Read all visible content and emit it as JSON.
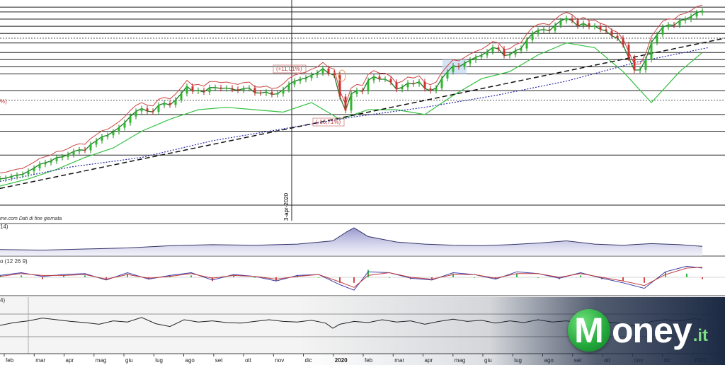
{
  "chart_data": {
    "type": "line",
    "title": "",
    "source_caption": "me.com Dati di fine giornata",
    "crosshair_date_label": "3-apr-2020",
    "x_tick_labels": [
      "feb",
      "mar",
      "apr",
      "mag",
      "giu",
      "lug",
      "ago",
      "set",
      "ott",
      "nov",
      "dic",
      "2020",
      "feb",
      "mar",
      "apr",
      "mag",
      "giu",
      "lug",
      "ago",
      "set",
      "ott",
      "nov",
      "dic",
      "2021"
    ],
    "annotations": [
      "(+11,01%)",
      "(-16,71%)",
      "%)"
    ],
    "panel_labels": {
      "atr": "14)",
      "macd": "o (12 26 9)",
      "rsi": "4)"
    },
    "price_series": {
      "name": "",
      "x_index": [
        0,
        8,
        16,
        24,
        32,
        40,
        48,
        56,
        64,
        72,
        80,
        88,
        96,
        104,
        112,
        120,
        128,
        136,
        144,
        152,
        160,
        168,
        176,
        184,
        192,
        200,
        208,
        216,
        224,
        232,
        240,
        248,
        256,
        264,
        272,
        280,
        288,
        296,
        304,
        312,
        320,
        328,
        336,
        344,
        352,
        360,
        368,
        376,
        384,
        392,
        400,
        408,
        416,
        424,
        432,
        440,
        448,
        456,
        464,
        472,
        480,
        488,
        496,
        504,
        512,
        520,
        528,
        536,
        544,
        552,
        560,
        568,
        576,
        584,
        592,
        600,
        608,
        616,
        624,
        632,
        640,
        648,
        656,
        664,
        672,
        680,
        688,
        696,
        704,
        712,
        720,
        728,
        736,
        744,
        752,
        760,
        768,
        776,
        784,
        792,
        800,
        808,
        816,
        824,
        832,
        840,
        848,
        856,
        864,
        872,
        880,
        888,
        896,
        904,
        912,
        920,
        928,
        936,
        944,
        952,
        960,
        968,
        976,
        984,
        992
      ],
      "values": [
        11,
        11.3,
        12,
        12.6,
        12.9,
        14.2,
        15.5,
        17.1,
        17.8,
        18.5,
        20,
        20.2,
        21.2,
        22.5,
        23.2,
        23,
        25.4,
        27,
        28.7,
        29.3,
        30.8,
        32.5,
        34.5,
        37.2,
        39.3,
        40.5,
        39.4,
        39.1,
        41.9,
        42.7,
        42,
        44.1,
        46.8,
        49.8,
        47.8,
        48.1,
        47.4,
        49.3,
        49.3,
        48.9,
        49.1,
        48.6,
        48.1,
        48.9,
        49.1,
        47.1,
        47,
        47.4,
        46.4,
        46.7,
        48.4,
        50.6,
        52,
        52.7,
        53.3,
        54.5,
        55.4,
        57.3,
        55.3,
        54.5,
        45.5,
        39.7,
        46.6,
        48.1,
        47.7,
        52.3,
        53.9,
        52.8,
        52.8,
        51.5,
        48.6,
        49.4,
        51.2,
        50.8,
        51.7,
        48.9,
        48,
        49.1,
        53.1,
        55.9,
        58.4,
        58,
        59.4,
        60.8,
        62,
        62.8,
        64.3,
        66.1,
        65.5,
        62.7,
        63.1,
        64.8,
        65.7,
        69.2,
        71.9,
        73.3,
        73.6,
        73.1,
        75.4,
        77.3,
        78.3,
        77.4,
        75.1,
        76.2,
        74.9,
        75.1,
        73.7,
        73,
        71,
        70,
        67.2,
        61.8,
        56.6,
        56.7,
        61,
        68.2,
        71.5,
        74.6,
        75.6,
        75.4,
        77.3,
        77.9,
        79.1,
        80.7,
        81.4
      ]
    },
    "volatility_band": {
      "name": "",
      "x_index": [
        0,
        40,
        80,
        120,
        160,
        200,
        240,
        280,
        320,
        360,
        400,
        440,
        480,
        520,
        560,
        600,
        640,
        680,
        720,
        760,
        800,
        840,
        880,
        920,
        960,
        992
      ],
      "values": [
        8,
        11,
        15,
        20,
        24,
        31,
        36,
        40,
        41,
        40,
        39,
        43,
        36,
        40,
        40,
        38,
        46,
        53,
        56,
        63,
        68,
        66,
        56,
        43,
        56,
        64
      ]
    },
    "moving_average_dotted": {
      "name": "",
      "x_index": [
        0,
        100,
        200,
        300,
        400,
        500,
        600,
        700,
        800,
        900,
        1000
      ],
      "values": [
        10,
        16,
        20,
        27,
        32,
        37,
        41,
        46,
        52,
        60,
        66
      ]
    },
    "trendline_dashed": {
      "name": "",
      "x_index": [
        0,
        1024
      ],
      "values": [
        7,
        70
      ]
    },
    "horizontal_levels": [
      83,
      81,
      78,
      75,
      72,
      70,
      68,
      64,
      61,
      58,
      55,
      48,
      44,
      38,
      31,
      21
    ],
    "atr": {
      "name": "",
      "x_index": [
        0,
        60,
        120,
        180,
        240,
        300,
        360,
        420,
        470,
        490,
        500,
        520,
        560,
        600,
        640,
        680,
        720,
        760,
        800,
        840,
        880,
        920,
        960,
        992
      ],
      "values": [
        1.2,
        1.1,
        1.3,
        1.5,
        1.9,
        2.1,
        2.0,
        2.2,
        2.8,
        4.5,
        5.2,
        3.6,
        2.6,
        2.2,
        2.0,
        1.9,
        2.1,
        2.4,
        2.8,
        2.2,
        2.0,
        2.3,
        2.1,
        1.8
      ]
    },
    "macd": {
      "name": "",
      "x_index": [
        0,
        30,
        60,
        90,
        120,
        150,
        180,
        210,
        240,
        270,
        300,
        330,
        360,
        390,
        420,
        450,
        480,
        500,
        520,
        550,
        580,
        610,
        640,
        670,
        700,
        730,
        760,
        790,
        820,
        850,
        880,
        910,
        940,
        970,
        992
      ],
      "macd": [
        0.2,
        0.5,
        0.1,
        0.3,
        0.4,
        -0.3,
        0.5,
        -0.2,
        0.2,
        0.5,
        -0.3,
        0.3,
        0.1,
        -0.4,
        0.2,
        0.3,
        -0.8,
        -1.4,
        0.6,
        0.5,
        -0.1,
        -0.3,
        0.5,
        0.3,
        -0.2,
        0.6,
        0.4,
        -0.1,
        0.5,
        -0.1,
        -0.6,
        -1.2,
        0.6,
        1.2,
        1.0
      ],
      "signal": [
        0.1,
        0.4,
        0.2,
        0.2,
        0.3,
        -0.2,
        0.3,
        -0.1,
        0.1,
        0.4,
        -0.1,
        0.2,
        0.1,
        -0.2,
        0.1,
        0.3,
        -0.5,
        -1.1,
        0.2,
        0.5,
        0.0,
        -0.2,
        0.3,
        0.3,
        -0.1,
        0.4,
        0.4,
        0.0,
        0.4,
        0.0,
        -0.4,
        -0.9,
        0.3,
        1.0,
        1.1
      ]
    },
    "rsi": {
      "name": "",
      "x_index": [
        0,
        20,
        40,
        60,
        80,
        100,
        120,
        140,
        160,
        180,
        200,
        220,
        240,
        260,
        280,
        300,
        320,
        340,
        360,
        380,
        400,
        420,
        440,
        460,
        470,
        480,
        500,
        520,
        540,
        560,
        580,
        600,
        620,
        640,
        660,
        680,
        700,
        720,
        740,
        760,
        780,
        800,
        820,
        840,
        860,
        880,
        900,
        920,
        940,
        960,
        980,
        992
      ],
      "values": [
        50,
        55,
        58,
        63,
        60,
        57,
        55,
        52,
        58,
        56,
        64,
        53,
        48,
        60,
        56,
        58,
        55,
        54,
        57,
        60,
        57,
        56,
        59,
        54,
        45,
        52,
        57,
        55,
        60,
        56,
        58,
        52,
        57,
        61,
        57,
        59,
        54,
        58,
        55,
        60,
        56,
        58,
        54,
        52,
        56,
        53,
        48,
        57,
        60,
        58,
        62,
        60
      ]
    }
  }
}
